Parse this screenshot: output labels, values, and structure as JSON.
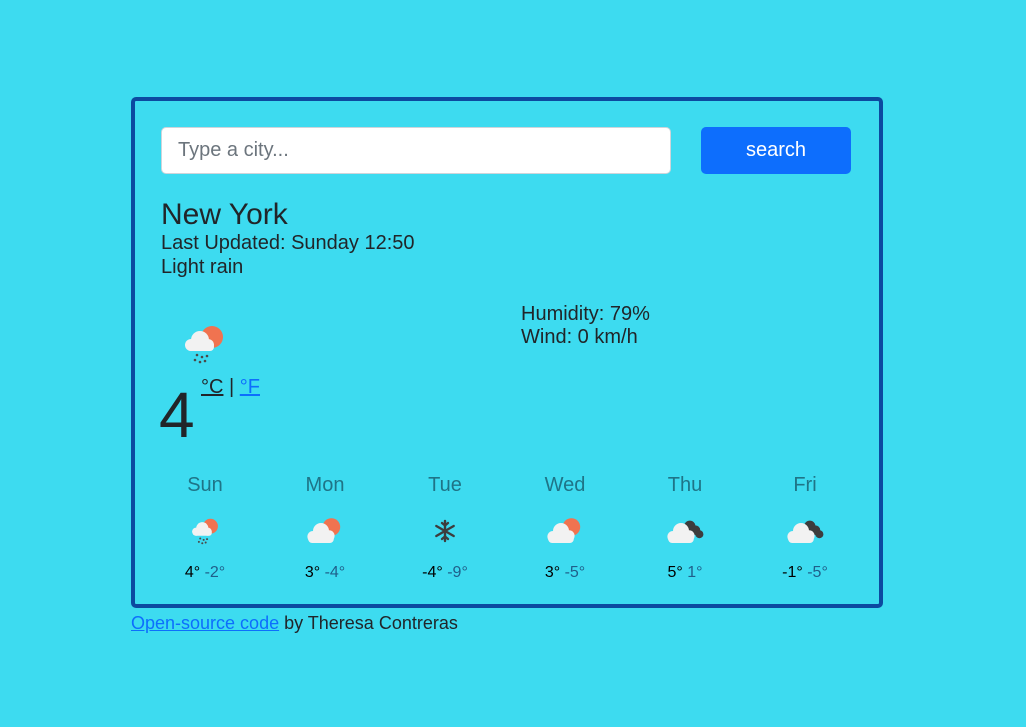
{
  "search": {
    "placeholder": "Type a city...",
    "value": "",
    "button_label": "search"
  },
  "current": {
    "city": "New York",
    "last_updated": "Last Updated: Sunday 12:50",
    "description": "Light rain",
    "icon": "rain-cloud-sun-icon",
    "temperature": "4",
    "unit_celsius": "°C",
    "unit_separator": "|",
    "unit_fahrenheit": "°F",
    "humidity": "Humidity: 79%",
    "wind": "Wind: 0 km/h"
  },
  "forecast": [
    {
      "day": "Sun",
      "icon": "rain-cloud-sun-icon",
      "max": "4°",
      "min": "-2°"
    },
    {
      "day": "Mon",
      "icon": "cloud-sun-icon",
      "max": "3°",
      "min": "-4°"
    },
    {
      "day": "Tue",
      "icon": "snowflake-icon",
      "max": "-4°",
      "min": "-9°"
    },
    {
      "day": "Wed",
      "icon": "cloud-sun-icon",
      "max": "3°",
      "min": "-5°"
    },
    {
      "day": "Thu",
      "icon": "dark-clouds-icon",
      "max": "5°",
      "min": "1°"
    },
    {
      "day": "Fri",
      "icon": "dark-clouds-icon",
      "max": "-1°",
      "min": "-5°"
    }
  ],
  "footer": {
    "link_text": "Open-source code",
    "suffix": " by Theresa Contreras"
  },
  "colors": {
    "background": "#3ddbf0",
    "border": "#0c4aa0",
    "button": "#0d6efd",
    "sun": "#f07350",
    "cloud": "#f2f2f2",
    "dark_cloud": "#3d3d3d"
  }
}
